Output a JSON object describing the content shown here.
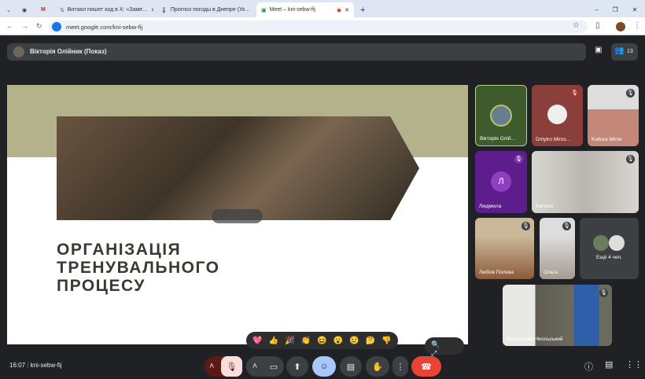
{
  "browser": {
    "tabs": [
      {
        "label": "Витаял пишет код в Х: «Заме…",
        "icon": "x-icon"
      },
      {
        "label": "Прогноз погоды в Днепре (Ук…",
        "icon": "thermometer-icon"
      },
      {
        "label": "Meet – kni-sebw-fij",
        "icon": "meet-icon"
      }
    ],
    "url": "meet.google.com/kni-sebw-fij"
  },
  "meeting": {
    "presenter": "Вікторія Олійник (Показ)",
    "participant_count": "13",
    "slide": {
      "title_lines": [
        "ОРГАНІЗАЦІЯ",
        "ТРЕНУВАЛЬНОГО",
        "ПРОЦЕСУ"
      ]
    },
    "participants": [
      {
        "name": "Вікторія Олій…",
        "bg": "#3f5a2c"
      },
      {
        "name": "Dmytro Miros…",
        "bg": "#8a3f3a"
      },
      {
        "name": "Kultura Mirne",
        "bg": "#c4887a"
      },
      {
        "name": "Людмила",
        "bg": "#6a1b9a",
        "initial": "Л"
      },
      {
        "name": "Євгенія",
        "bg": "#b9b6b0"
      },
      {
        "name": "Любов Полєва",
        "bg": "#8d7b66"
      },
      {
        "name": "Ольга",
        "bg": "#a59a90"
      },
      {
        "name": "Владислав Нікольський",
        "bg": "#6d6a5e"
      }
    ],
    "more": "Ещё 4 чел.",
    "reactions": [
      "💖",
      "👍",
      "🎉",
      "👏",
      "😆",
      "😮",
      "😢",
      "🤔",
      "👎"
    ],
    "time": "16:07",
    "code": "kni-sebw-fij"
  }
}
